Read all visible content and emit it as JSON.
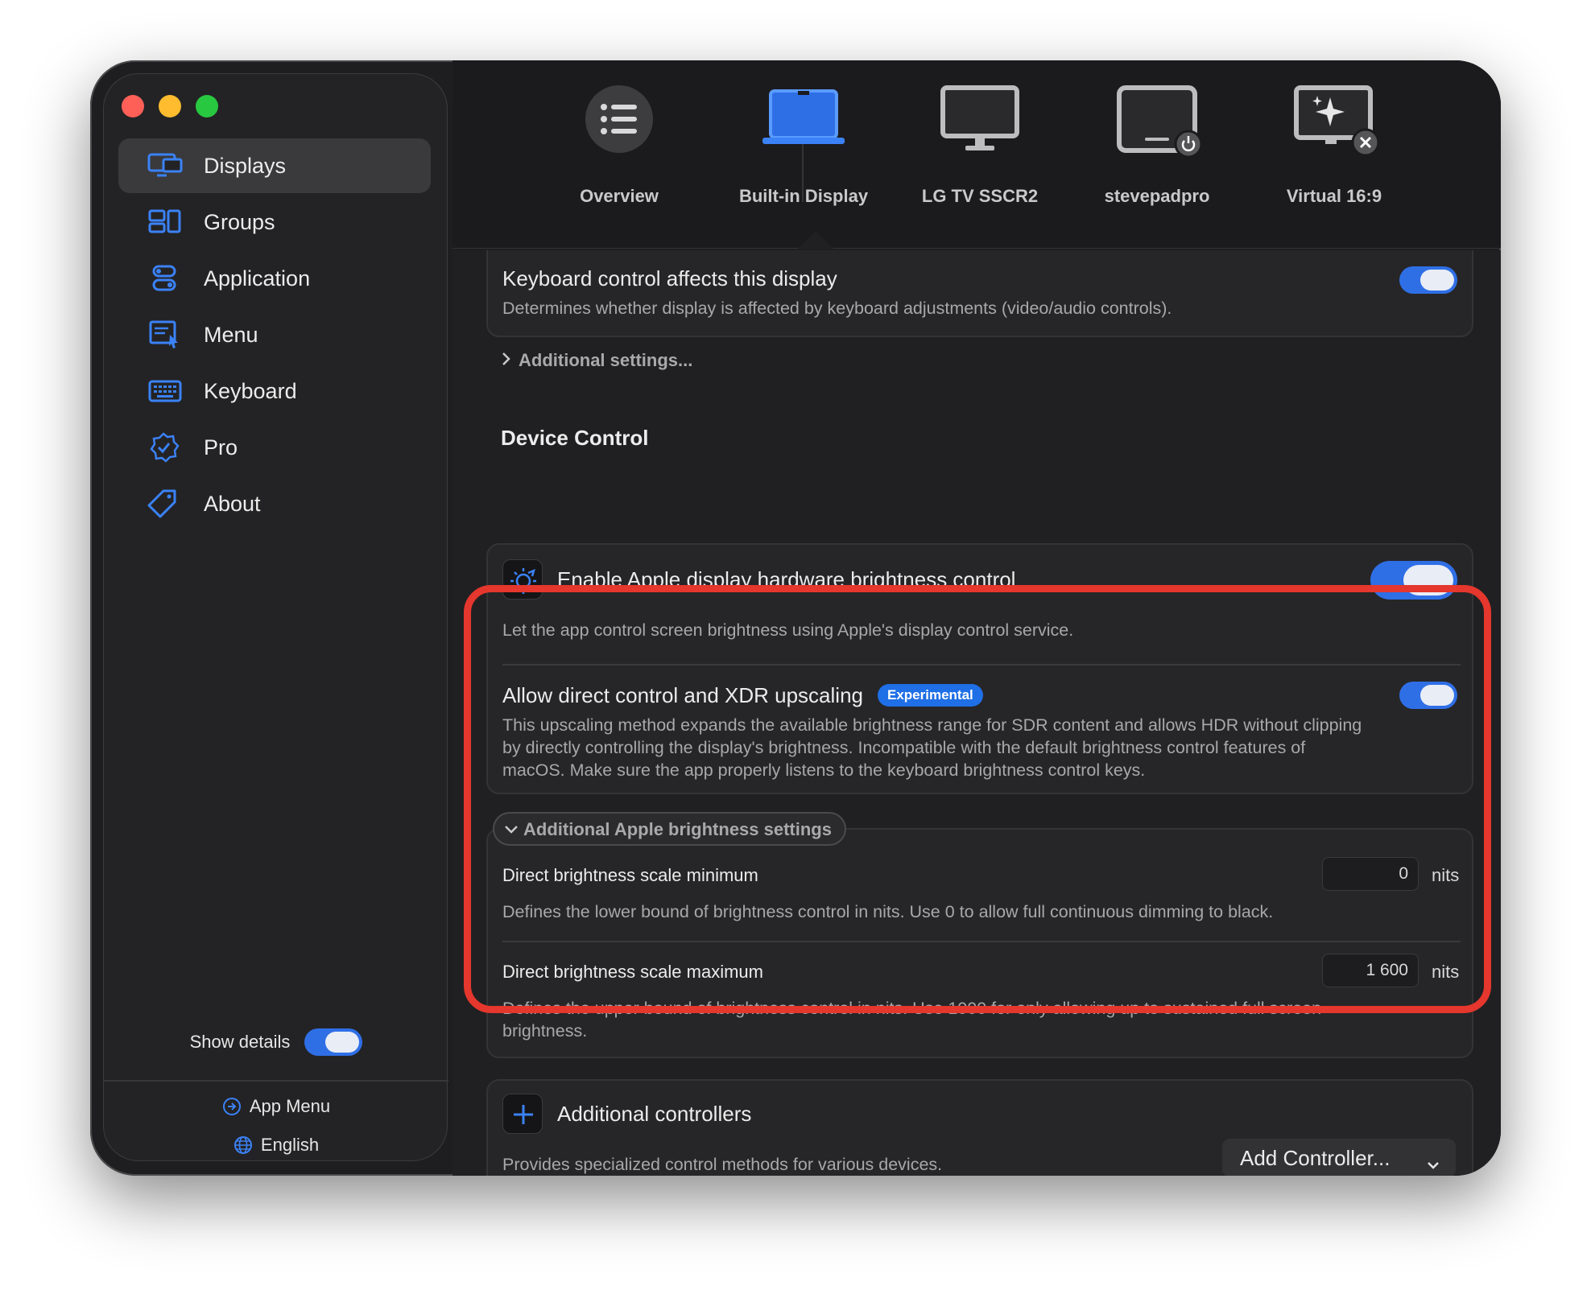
{
  "sidebar": {
    "items": [
      {
        "label": "Displays",
        "icon": "displays-icon"
      },
      {
        "label": "Groups",
        "icon": "groups-icon"
      },
      {
        "label": "Application",
        "icon": "application-icon"
      },
      {
        "label": "Menu",
        "icon": "menu-icon"
      },
      {
        "label": "Keyboard",
        "icon": "keyboard-icon"
      },
      {
        "label": "Pro",
        "icon": "pro-badge-icon"
      },
      {
        "label": "About",
        "icon": "tag-icon"
      }
    ],
    "show_details_label": "Show details",
    "app_menu_label": "App Menu",
    "language_label": "English"
  },
  "toolbar": {
    "items": [
      {
        "label": "Overview"
      },
      {
        "label": "Built-in Display"
      },
      {
        "label": "LG TV SSCR2"
      },
      {
        "label": "stevepadpro"
      },
      {
        "label": "Virtual 16:9"
      }
    ]
  },
  "content": {
    "keyboard_control": {
      "title": "Keyboard control affects this display",
      "desc": "Determines whether display is affected by keyboard adjustments (video/audio controls)."
    },
    "additional_settings_label": "Additional settings...",
    "device_control_heading": "Device Control",
    "apple_brightness": {
      "title": "Enable Apple display hardware brightness control",
      "desc": "Let the app control screen brightness using Apple's display control service."
    },
    "direct_control": {
      "title": "Allow direct control and XDR upscaling",
      "badge": "Experimental",
      "desc_lines": [
        "This upscaling method expands the available brightness range for SDR content and allows HDR without clipping",
        "by directly controlling the display's brightness. Incompatible with the default brightness control features of",
        "macOS. Make sure the app properly listens to the keyboard brightness control keys."
      ]
    },
    "additional_apple_label": "Additional Apple brightness settings",
    "scale_min": {
      "title": "Direct brightness scale minimum",
      "value": "0",
      "unit": "nits",
      "desc": "Defines the lower bound of brightness control in nits. Use 0 to allow full continuous dimming to black."
    },
    "scale_max": {
      "title": "Direct brightness scale maximum",
      "value": "1 600",
      "unit": "nits",
      "desc_lines": [
        "Defines the upper bound of brightness control in nits. Use 1000 for only allowing up to sustained full screen",
        "brightness."
      ]
    },
    "controllers": {
      "title": "Additional controllers",
      "desc": "Provides specialized control methods for various devices.",
      "add_button": "Add Controller..."
    }
  },
  "colors": {
    "accent": "#2f6fe6",
    "highlight": "#e5372d",
    "window_bg": "#1e1e20"
  }
}
